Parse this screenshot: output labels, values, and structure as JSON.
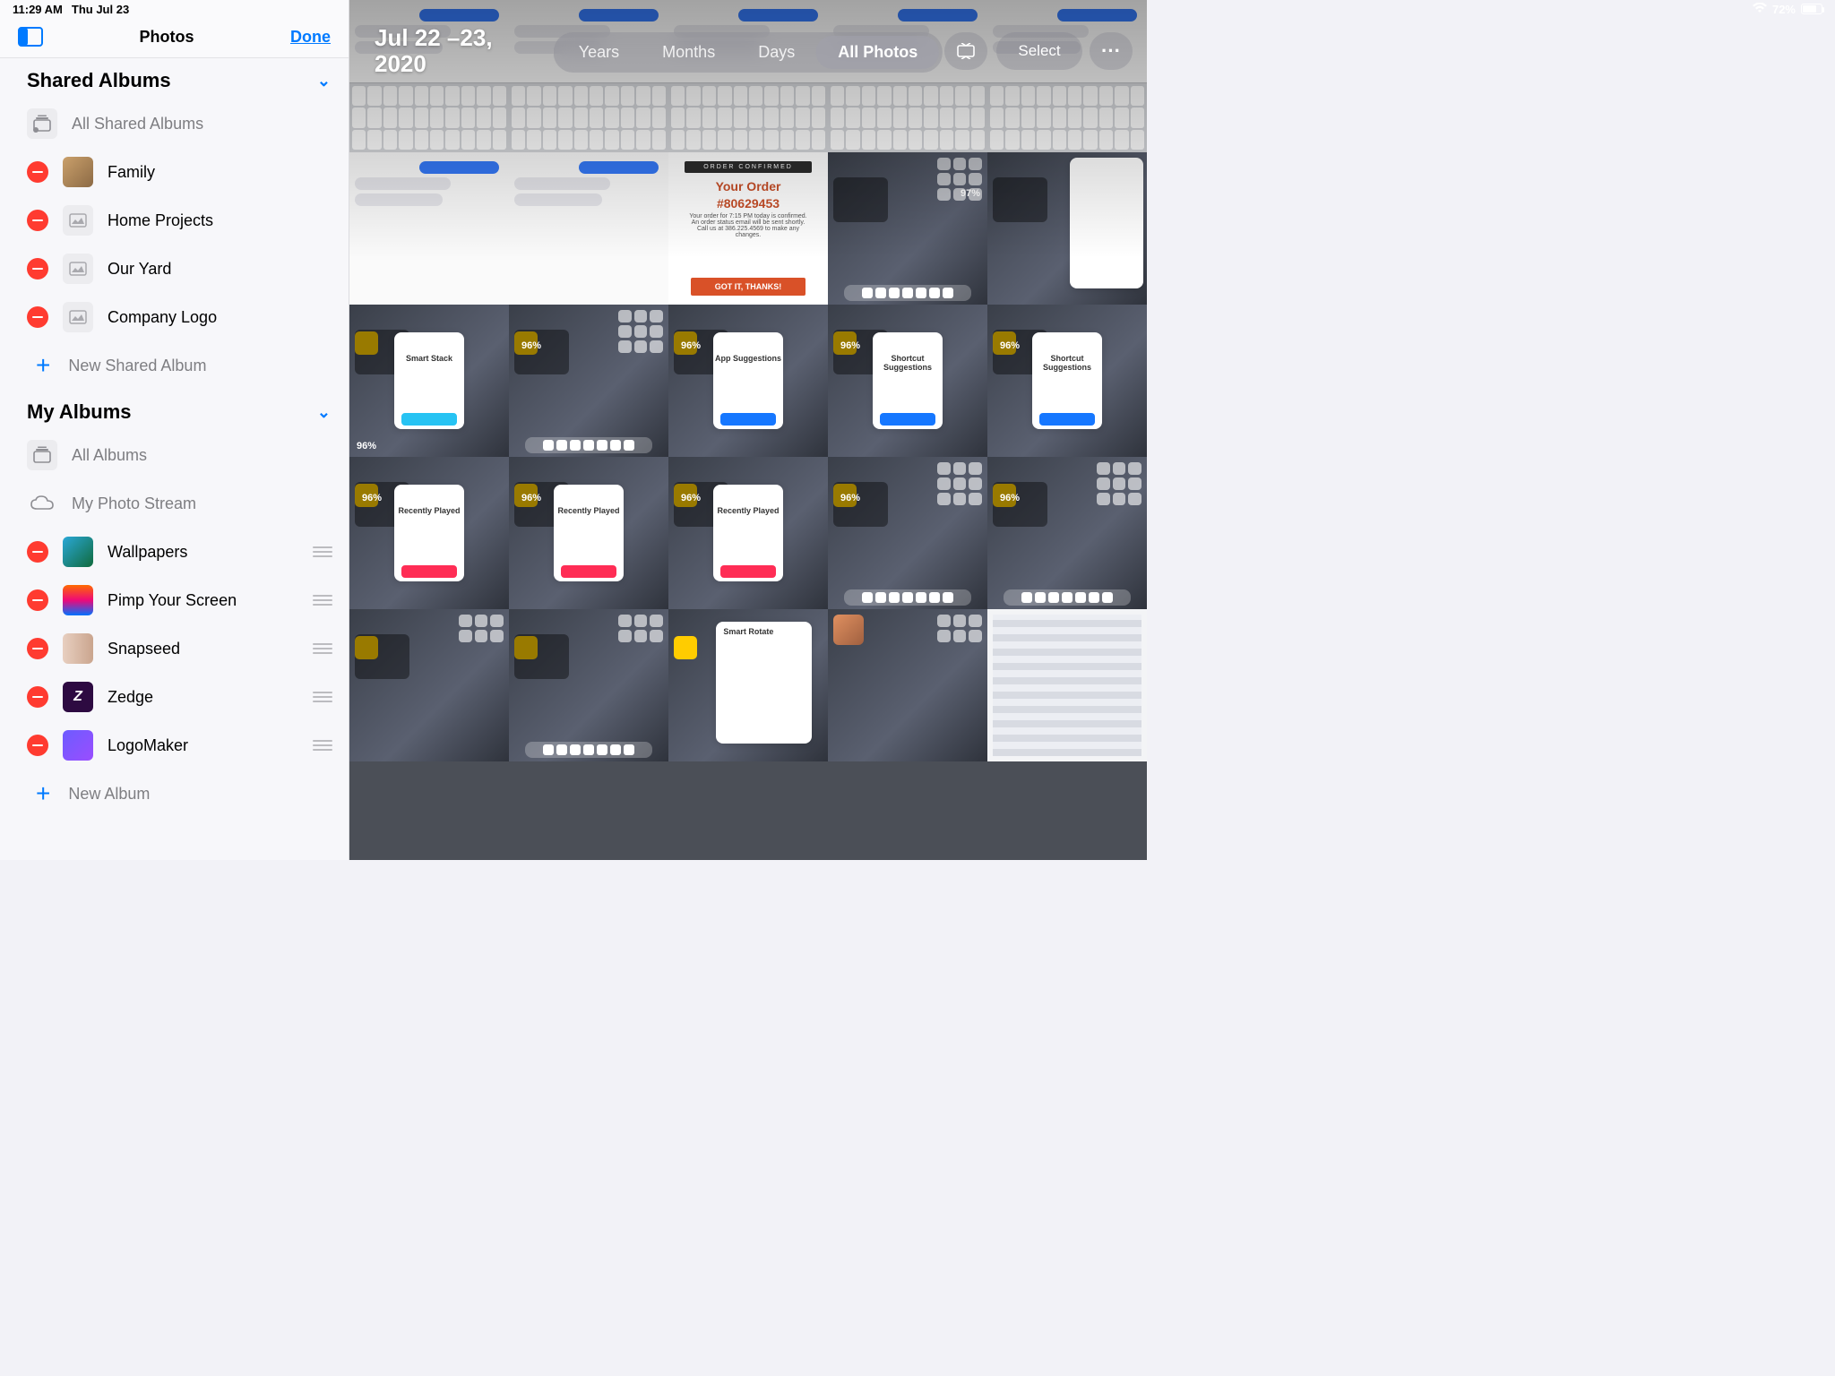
{
  "status": {
    "time": "11:29 AM",
    "date": "Thu Jul 23",
    "battery": "72%"
  },
  "sidebar": {
    "title": "Photos",
    "done": "Done",
    "sections": [
      {
        "title": "Shared Albums",
        "staticRows": [
          {
            "label": "All Shared Albums",
            "icon": "album-stack"
          }
        ],
        "editableRows": [
          {
            "label": "Family",
            "swatch": "sw-family",
            "hasHandle": false,
            "hasThumb": true
          },
          {
            "label": "Home Projects",
            "swatch": "icon",
            "hasHandle": false
          },
          {
            "label": "Our Yard",
            "swatch": "icon",
            "hasHandle": false
          },
          {
            "label": "Company Logo",
            "swatch": "icon",
            "hasHandle": false
          }
        ],
        "addLabel": "New Shared Album"
      },
      {
        "title": "My Albums",
        "staticRows": [
          {
            "label": "All Albums",
            "icon": "album-stack"
          },
          {
            "label": "My Photo Stream",
            "icon": "cloud"
          }
        ],
        "editableRows": [
          {
            "label": "Wallpapers",
            "swatch": "sw-wall",
            "hasHandle": true,
            "hasThumb": true
          },
          {
            "label": "Pimp Your Screen",
            "swatch": "sw-pimp",
            "hasHandle": true,
            "hasThumb": true
          },
          {
            "label": "Snapseed",
            "swatch": "sw-snap",
            "hasHandle": true,
            "hasThumb": true
          },
          {
            "label": "Zedge",
            "swatch": "sw-zedge",
            "hasHandle": true,
            "hasThumb": true,
            "glyph": "Z"
          },
          {
            "label": "LogoMaker",
            "swatch": "sw-logo",
            "hasHandle": true,
            "hasThumb": true
          }
        ],
        "addLabel": "New Album"
      }
    ]
  },
  "main": {
    "dateRange": "Jul 22 – 23, 2020",
    "segments": [
      "Years",
      "Months",
      "Days",
      "All Photos"
    ],
    "activeSegment": 3,
    "selectLabel": "Select",
    "order": {
      "head": "ORDER CONFIRMED",
      "title1": "Your Order",
      "title2": "#80629453",
      "body": "Your order for 7:15 PM today is confirmed. An order status email will be sent shortly. Call us at 386.225.4569 to make any changes.",
      "btn": "GOT IT, THANKS!"
    },
    "widgetTitles": {
      "smartStack": "Smart Stack",
      "appSug": "App Suggestions",
      "shortcut": "Shortcut Suggestions",
      "recent": "Recently Played",
      "smartRotate": "Smart Rotate"
    },
    "pct": "96%",
    "pct2": "97%"
  }
}
